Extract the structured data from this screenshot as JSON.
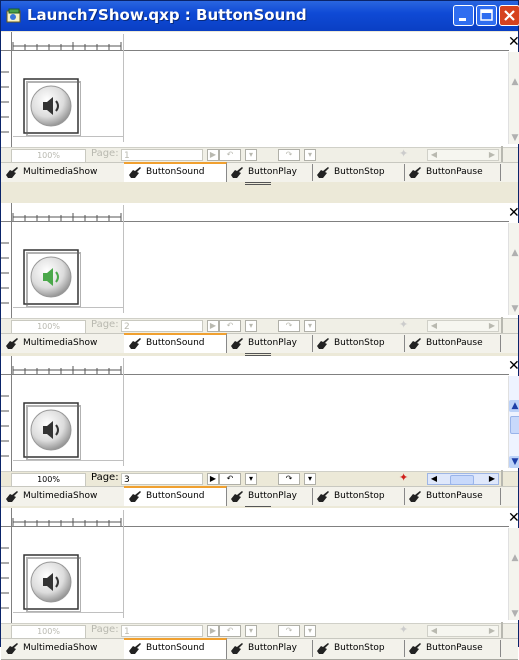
{
  "window": {
    "title": "Launch7Show.qxp : ButtonSound"
  },
  "colors": {
    "titlebar": "#0f4ad6",
    "tab_highlight": "#f0a030",
    "close_button": "#d6421f"
  },
  "icons": {
    "app": "quark-document-icon",
    "tab": "pointing-hand-icon",
    "sound": "speaker-icon",
    "close_pane": "close-icon"
  },
  "panes": [
    {
      "zoom": "100%",
      "page_label": "Page:",
      "page": "1",
      "active": false,
      "tabs": [
        "MultimediaShow",
        "ButtonSound",
        "ButtonPlay",
        "ButtonStop",
        "ButtonPause"
      ],
      "selected_tab": 1
    },
    {
      "zoom": "100%",
      "page_label": "Page:",
      "page": "2",
      "active": false,
      "tabs": [
        "MultimediaShow",
        "ButtonSound",
        "ButtonPlay",
        "ButtonStop",
        "ButtonPause"
      ],
      "selected_tab": 1
    },
    {
      "zoom": "100%",
      "page_label": "Page:",
      "page": "3",
      "active": true,
      "tabs": [
        "MultimediaShow",
        "ButtonSound",
        "ButtonPlay",
        "ButtonStop",
        "ButtonPause"
      ],
      "selected_tab": 1
    },
    {
      "zoom": "100%",
      "page_label": "Page:",
      "page": "1",
      "active": false,
      "tabs": [
        "MultimediaShow",
        "ButtonSound",
        "ButtonPlay",
        "ButtonStop",
        "ButtonPause"
      ],
      "selected_tab": 1
    }
  ]
}
